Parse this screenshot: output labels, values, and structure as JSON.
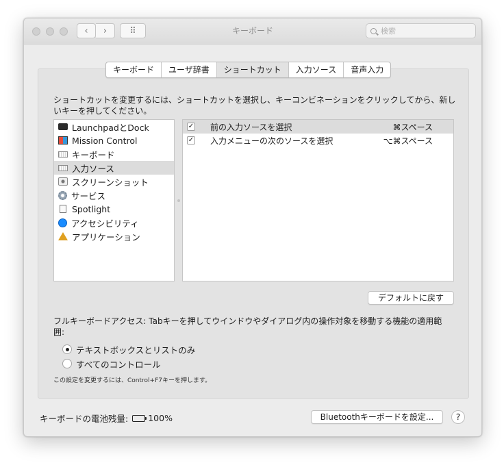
{
  "window": {
    "title": "キーボード",
    "search_placeholder": "検索",
    "nav": {
      "back_glyph": "‹",
      "forward_glyph": "›",
      "grid_glyph": "⠿"
    }
  },
  "tabs": [
    {
      "label": "キーボード",
      "active": false
    },
    {
      "label": "ユーザ辞書",
      "active": false
    },
    {
      "label": "ショートカット",
      "active": true
    },
    {
      "label": "入力ソース",
      "active": false
    },
    {
      "label": "音声入力",
      "active": false
    }
  ],
  "instruction": "ショートカットを変更するには、ショートカットを選択し、キーコンビネーションをクリックしてから、新しいキーを押してください。",
  "categories": [
    {
      "label": "LaunchpadとDock",
      "icon": "launchpad-icon"
    },
    {
      "label": "Mission Control",
      "icon": "mission-control-icon"
    },
    {
      "label": "キーボード",
      "icon": "keyboard-icon"
    },
    {
      "label": "入力ソース",
      "icon": "input-source-icon",
      "selected": true
    },
    {
      "label": "スクリーンショット",
      "icon": "screenshot-icon"
    },
    {
      "label": "サービス",
      "icon": "gear-icon"
    },
    {
      "label": "Spotlight",
      "icon": "spotlight-icon"
    },
    {
      "label": "アクセシビリティ",
      "icon": "accessibility-icon"
    },
    {
      "label": "アプリケーション",
      "icon": "applications-icon"
    }
  ],
  "shortcuts": [
    {
      "checked": true,
      "check_glyph": "✓",
      "label": "前の入力ソースを選択",
      "keys": "⌘スペース",
      "selected": true
    },
    {
      "checked": true,
      "check_glyph": "✓",
      "label": "入力メニューの次のソースを選択",
      "keys": "⌥⌘スペース",
      "selected": false
    }
  ],
  "restore_defaults_label": "デフォルトに戻す",
  "full_keyboard_access": {
    "text": "フルキーボードアクセス: Tabキーを押してウインドウやダイアログ内の操作対象を移動する機能の適用範囲:",
    "options": [
      {
        "label": "テキストボックスとリストのみ",
        "selected": true
      },
      {
        "label": "すべてのコントロール",
        "selected": false
      }
    ],
    "note": "この設定を変更するには、Control+F7キーを押します。"
  },
  "battery": {
    "label": "キーボードの電池残量:",
    "level": "100%"
  },
  "bluetooth_button_label": "Bluetoothキーボードを設定...",
  "help_glyph": "?"
}
